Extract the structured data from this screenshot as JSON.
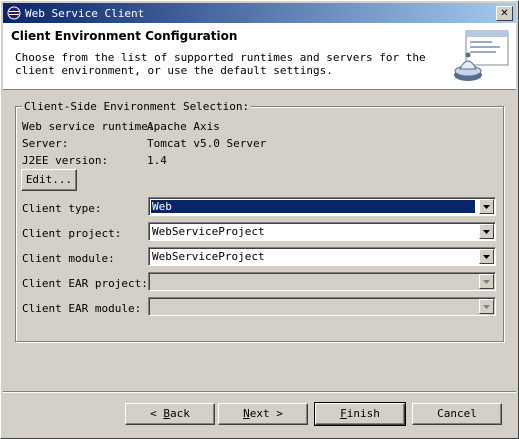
{
  "window": {
    "title": "Web Service Client"
  },
  "header": {
    "title": "Client Environment Configuration",
    "description": "Choose from the list of supported runtimes and servers for the client environment, or use the default settings."
  },
  "group": {
    "legend": "Client-Side Environment Selection:",
    "runtime_label": "Web service runtime:",
    "runtime_value": "Apache Axis",
    "server_label": "Server:",
    "server_value": "Tomcat v5.0 Server",
    "j2ee_label": "J2EE version:",
    "j2ee_value": "1.4",
    "edit_button": "Edit...",
    "client_type_label": "Client type:",
    "client_type_value": "Web",
    "client_project_label": "Client project:",
    "client_project_value": "WebServiceProject",
    "client_module_label": "Client module:",
    "client_module_value": "WebServiceProject",
    "client_ear_project_label": "Client EAR project:",
    "client_ear_project_value": "",
    "client_ear_module_label": "Client EAR module:",
    "client_ear_module_value": ""
  },
  "buttons": {
    "back_prefix": "< ",
    "back_mnemonic": "B",
    "back_rest": "ack",
    "next_mnemonic": "N",
    "next_rest": "ext >",
    "finish_mnemonic": "F",
    "finish_rest": "inish",
    "cancel": "Cancel"
  }
}
